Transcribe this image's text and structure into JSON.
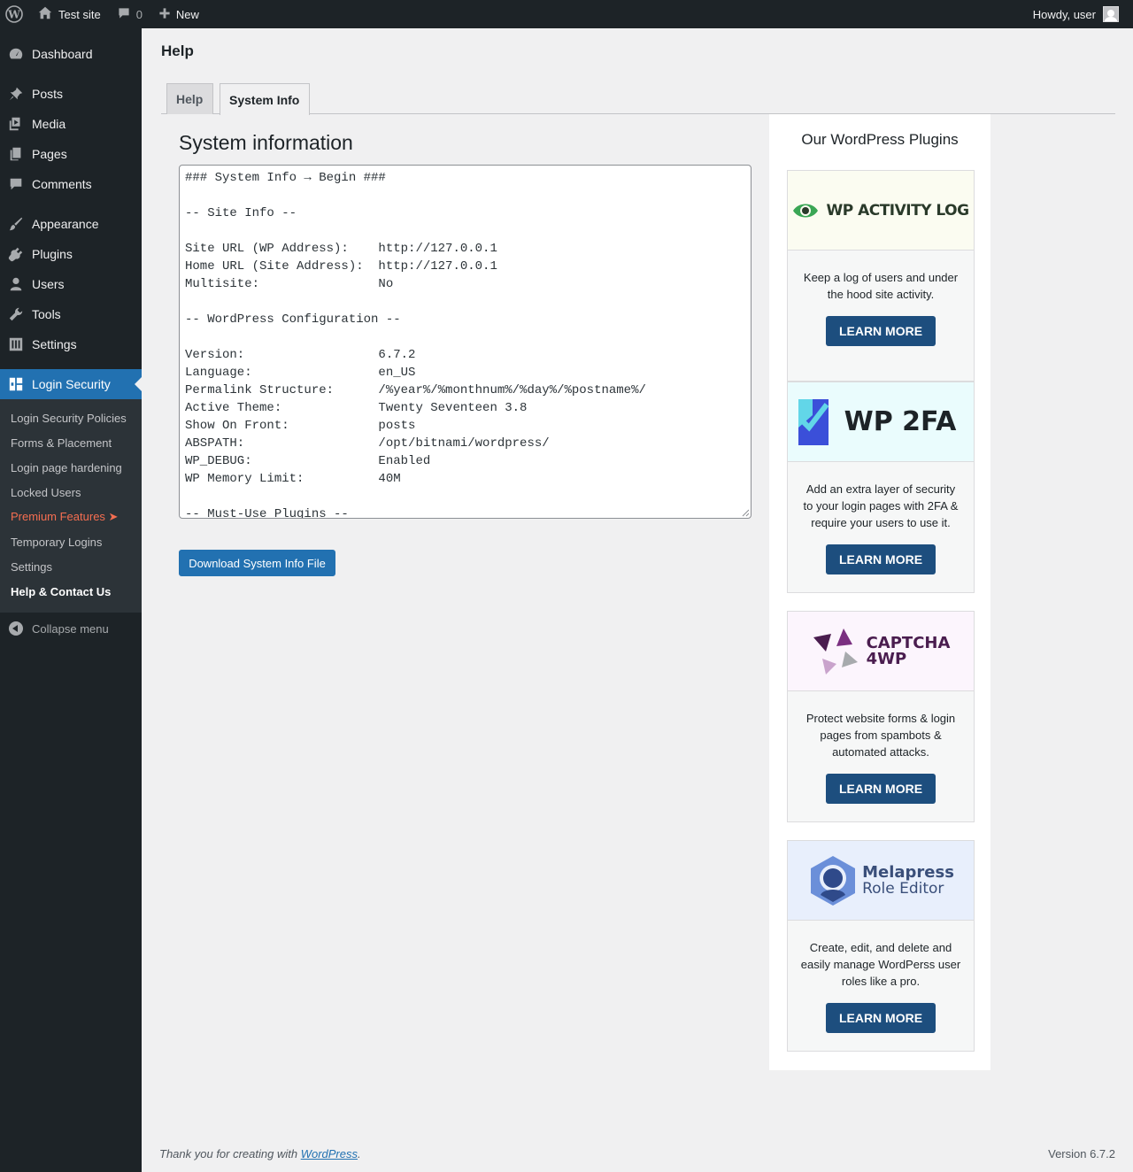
{
  "adminbar": {
    "site_name": "Test site",
    "comments_count": "0",
    "new_label": "New",
    "howdy": "Howdy, user"
  },
  "sidebar": {
    "items": [
      {
        "label": "Dashboard"
      },
      {
        "label": "Posts"
      },
      {
        "label": "Media"
      },
      {
        "label": "Pages"
      },
      {
        "label": "Comments"
      },
      {
        "label": "Appearance"
      },
      {
        "label": "Plugins"
      },
      {
        "label": "Users"
      },
      {
        "label": "Tools"
      },
      {
        "label": "Settings"
      },
      {
        "label": "Login Security"
      }
    ],
    "submenu": [
      {
        "label": "Login Security Policies"
      },
      {
        "label": "Forms & Placement"
      },
      {
        "label": "Login page hardening"
      },
      {
        "label": "Locked Users"
      },
      {
        "label": "Premium Features ➤"
      },
      {
        "label": "Temporary Logins"
      },
      {
        "label": "Settings"
      },
      {
        "label": "Help & Contact Us"
      }
    ],
    "collapse_label": "Collapse menu"
  },
  "main": {
    "page_title": "Help",
    "tabs": [
      {
        "label": "Help"
      },
      {
        "label": "System Info"
      }
    ],
    "section_title": "System information",
    "system_info_text": "### System Info → Begin ###\n\n-- Site Info --\n\nSite URL (WP Address):    http://127.0.0.1\nHome URL (Site Address):  http://127.0.0.1\nMultisite:                No\n\n-- WordPress Configuration --\n\nVersion:                  6.7.2\nLanguage:                 en_US\nPermalink Structure:      /%year%/%monthnum%/%day%/%postname%/\nActive Theme:             Twenty Seventeen 3.8\nShow On Front:            posts\nABSPATH:                  /opt/bitnami/wordpress/\nWP_DEBUG:                 Enabled\nWP Memory Limit:          40M\n\n-- Must-Use Plugins --",
    "download_label": "Download System Info File"
  },
  "plugins_panel": {
    "title": "Our WordPress Plugins",
    "cards": [
      {
        "name": "WP ACTIVITY LOG",
        "description": "Keep a log of users and under the hood site activity.",
        "cta": "LEARN MORE",
        "banner_bg": "#fbfcf1"
      },
      {
        "name": "WP 2FA",
        "description": "Add an extra layer of security to your login pages with 2FA & require your users to use it.",
        "cta": "LEARN MORE",
        "banner_bg": "#eafcfd"
      },
      {
        "name_line1": "CAPTCHA",
        "name_line2": "4WP",
        "description": "Protect website forms & login pages from spambots & automated attacks.",
        "cta": "LEARN MORE",
        "banner_bg": "#fcf5fd"
      },
      {
        "name_line1": "Melapress",
        "name_line2": "Role Editor",
        "description": "Create, edit, and delete and easily manage WordPerss user roles like a pro.",
        "cta": "LEARN MORE",
        "banner_bg": "#e8effc"
      }
    ]
  },
  "footer": {
    "thanks_prefix": "Thank you for creating with ",
    "thanks_link": "WordPress",
    "thanks_suffix": ".",
    "version": "Version 6.7.2"
  },
  "colors": {
    "admin_dark": "#1d2327",
    "accent_blue": "#2271b1",
    "premium_orange": "#f56e51",
    "learn_more_bg": "#1d4e7e"
  }
}
